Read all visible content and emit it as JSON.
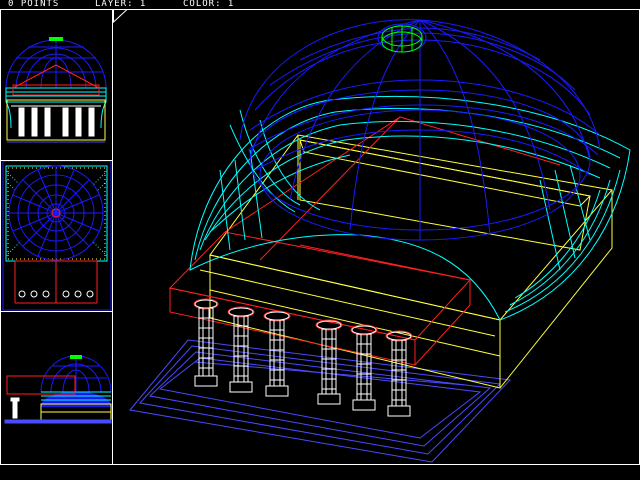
{
  "status_bar": {
    "points_label": "0 POINTS",
    "layer_label": "LAYER: 1",
    "color_label": "COLOR: 1"
  },
  "viewports": [
    {
      "id": "front",
      "icon": "front-elevation-view"
    },
    {
      "id": "plan",
      "icon": "plan-view"
    },
    {
      "id": "side",
      "icon": "side-elevation-view"
    },
    {
      "id": "perspective",
      "icon": "perspective-wireframe-view"
    }
  ],
  "colors": {
    "frame": "#ffffff",
    "dome": "#1a1aff",
    "pendentive": "#00ffff",
    "beam": "#ff2020",
    "base": "#ffff40",
    "columns": "#ffffff",
    "steps": "#4a4aff",
    "highlight": "#00ff00"
  }
}
